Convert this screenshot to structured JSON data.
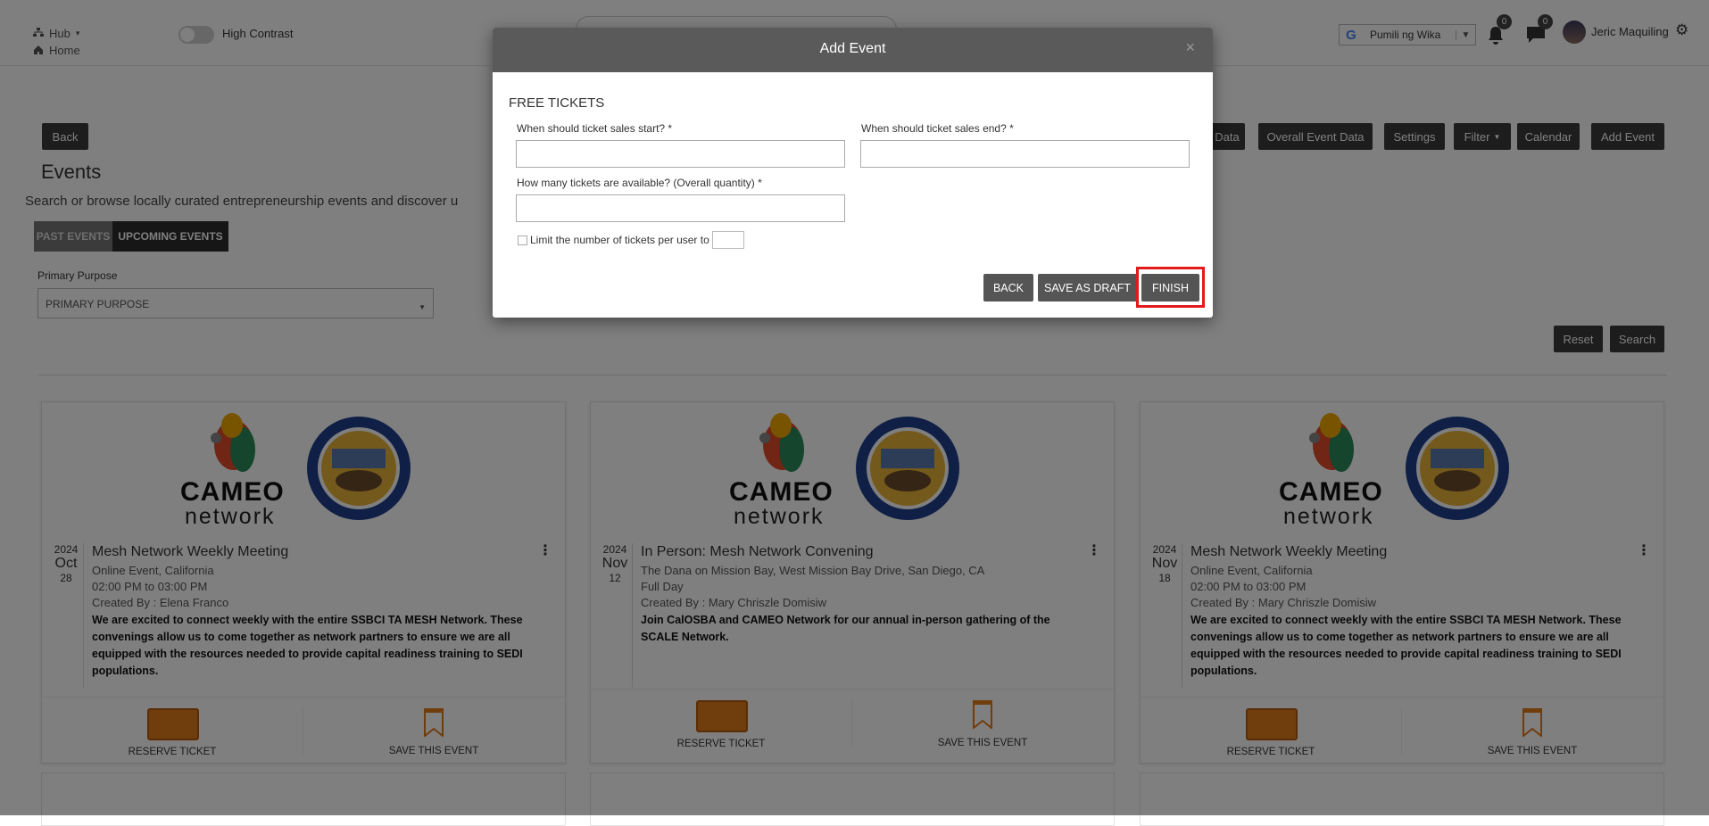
{
  "topbar": {
    "hub_label": "Hub",
    "home_label": "Home",
    "high_contrast_label": "High Contrast",
    "language_label": "Pumili ng Wika",
    "language_google": "G",
    "notifications_count": "0",
    "messages_count": "0",
    "user_name": "Jeric Maquiling"
  },
  "toolbar": {
    "back": "Back",
    "data": "Data",
    "overall_event_data": "Overall Event Data",
    "settings": "Settings",
    "filter": "Filter",
    "calendar": "Calendar",
    "add_event": "Add Event"
  },
  "page": {
    "title": "Events",
    "description": "Search or browse locally curated entrepreneurship events and discover u",
    "tab_past": "PAST EVENTS",
    "tab_upcoming": "UPCOMING EVENTS",
    "primary_purpose_label": "Primary Purpose",
    "primary_purpose_value": "PRIMARY PURPOSE",
    "reset": "Reset",
    "search": "Search"
  },
  "cards": [
    {
      "year": "2024",
      "month": "Oct",
      "day": "28",
      "title": "Mesh Network Weekly Meeting",
      "location": "Online Event, California",
      "time": "02:00 PM to 03:00 PM",
      "created_by": "Created By : Elena Franco",
      "desc": "We are excited to connect weekly with the entire  SSBCI TA MESH Network. These convenings allow us to come together as network partners to ensure we are all equipped with the resources needed to provide capital readiness training to SEDI populations.",
      "reserve": "RESERVE TICKET",
      "save": "SAVE THIS EVENT"
    },
    {
      "year": "2024",
      "month": "Nov",
      "day": "12",
      "title": "In Person: Mesh Network Convening",
      "location": "The Dana on Mission Bay, West Mission Bay Drive, San Diego, CA",
      "time": "Full Day",
      "created_by": "Created By : Mary Chriszle Domisiw",
      "desc": "Join CalOSBA and CAMEO Network for our annual in-person gathering of the SCALE Network.",
      "reserve": "RESERVE TICKET",
      "save": "SAVE THIS EVENT"
    },
    {
      "year": "2024",
      "month": "Nov",
      "day": "18",
      "title": "Mesh Network Weekly Meeting",
      "location": "Online Event, California",
      "time": "02:00 PM to 03:00 PM",
      "created_by": "Created By : Mary Chriszle Domisiw",
      "desc": "We are excited to connect weekly with the entire  SSBCI TA MESH Network. These convenings allow us to come together as network partners to ensure we are all equipped with the resources needed to provide capital readiness training to SEDI populations.",
      "reserve": "RESERVE TICKET",
      "save": "SAVE THIS EVENT"
    }
  ],
  "logo": {
    "cameo": "CAMEO",
    "network": "network"
  },
  "modal": {
    "title": "Add Event",
    "close": "×",
    "section_title": "FREE TICKETS",
    "sales_start_label": "When should ticket sales start? *",
    "sales_start_value": "",
    "sales_end_label": "When should ticket sales end? *",
    "sales_end_value": "",
    "quantity_label": "How many tickets are available? (Overall quantity) *",
    "quantity_value": "",
    "limit_label": "Limit the number of tickets per user to",
    "limit_value": "",
    "back": "BACK",
    "save_draft": "SAVE AS DRAFT",
    "finish": "FINISH"
  },
  "colors": {
    "overlay": "#000000",
    "modal_header": "#5a5a5a",
    "button_dark": "#3a3a3a",
    "ticket_orange": "#e07a1b",
    "highlight": "#e21a1a"
  }
}
